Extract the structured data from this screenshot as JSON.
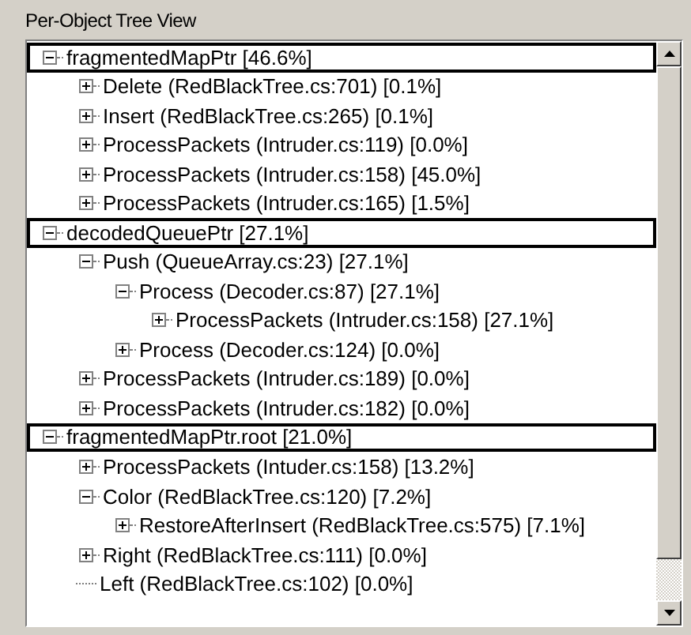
{
  "title": "Per-Object Tree View",
  "tree": [
    {
      "label": "fragmentedMapPtr [46.6%]",
      "kind": "branch",
      "expanded": true,
      "children": [
        {
          "label": "Delete (RedBlackTree.cs:701) [0.1%]",
          "kind": "branch",
          "expanded": false
        },
        {
          "label": "Insert (RedBlackTree.cs:265) [0.1%]",
          "kind": "branch",
          "expanded": false
        },
        {
          "label": "ProcessPackets (Intruder.cs:119) [0.0%]",
          "kind": "branch",
          "expanded": false
        },
        {
          "label": "ProcessPackets (Intruder.cs:158) [45.0%]",
          "kind": "branch",
          "expanded": false
        },
        {
          "label": "ProcessPackets (Intruder.cs:165) [1.5%]",
          "kind": "branch",
          "expanded": false
        }
      ]
    },
    {
      "label": "decodedQueuePtr [27.1%]",
      "kind": "branch",
      "expanded": true,
      "children": [
        {
          "label": "Push (QueueArray.cs:23) [27.1%]",
          "kind": "branch",
          "expanded": true,
          "children": [
            {
              "label": "Process (Decoder.cs:87) [27.1%]",
              "kind": "branch",
              "expanded": true,
              "children": [
                {
                  "label": "ProcessPackets (Intruder.cs:158) [27.1%]",
                  "kind": "branch",
                  "expanded": false
                }
              ]
            },
            {
              "label": "Process (Decoder.cs:124) [0.0%]",
              "kind": "branch",
              "expanded": false
            }
          ]
        },
        {
          "label": "ProcessPackets (Intruder.cs:189) [0.0%]",
          "kind": "branch",
          "expanded": false
        },
        {
          "label": "ProcessPackets (Intruder.cs:182) [0.0%]",
          "kind": "branch",
          "expanded": false
        }
      ]
    },
    {
      "label": "fragmentedMapPtr.root [21.0%]",
      "kind": "branch",
      "expanded": true,
      "children": [
        {
          "label": "ProcessPackets (Intuder.cs:158) [13.2%]",
          "kind": "branch",
          "expanded": false
        },
        {
          "label": "Color (RedBlackTree.cs:120) [7.2%]",
          "kind": "branch",
          "expanded": true,
          "children": [
            {
              "label": "RestoreAfterInsert (RedBlackTree.cs:575) [7.1%]",
              "kind": "branch",
              "expanded": false
            }
          ]
        },
        {
          "label": "Right (RedBlackTree.cs:111) [0.0%]",
          "kind": "branch",
          "expanded": false
        },
        {
          "label": "Left (RedBlackTree.cs:102) [0.0%]",
          "kind": "leaf"
        }
      ]
    }
  ]
}
